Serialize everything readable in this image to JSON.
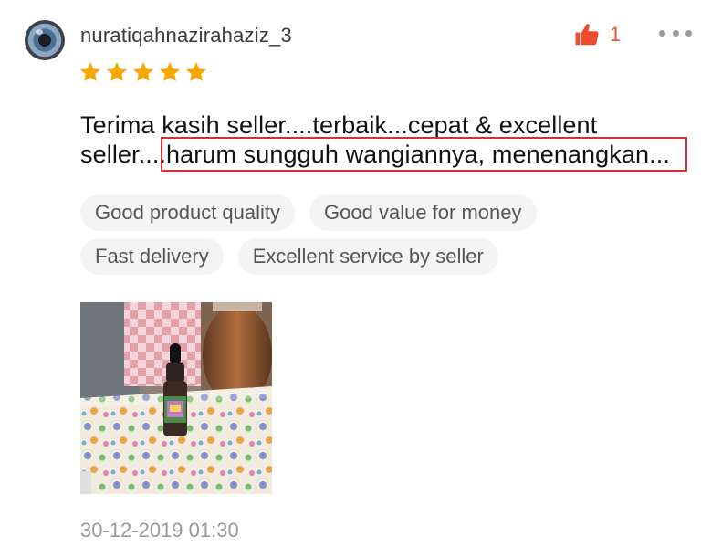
{
  "review": {
    "username": "nuratiqahnazirahaziz_3",
    "likes": "1",
    "rating": 5,
    "comment": "Terima kasih seller....terbaik...cepat & excellent seller....harum sungguh wangiannya, menenangkan...",
    "tags": [
      "Good product quality",
      "Good value for money",
      "Fast delivery",
      "Excellent service by seller"
    ],
    "timestamp": "30-12-2019 01:30"
  },
  "icons": {
    "avatar": "avatar-image",
    "like": "thumbs-up-icon",
    "more": "more-options-icon",
    "star": "star-icon"
  },
  "colors": {
    "accent": "#ee4d2d",
    "star": "#f6a700",
    "highlight": "#d13238",
    "tag_background": "#f4f4f4",
    "muted_text": "#9a9a9a"
  }
}
